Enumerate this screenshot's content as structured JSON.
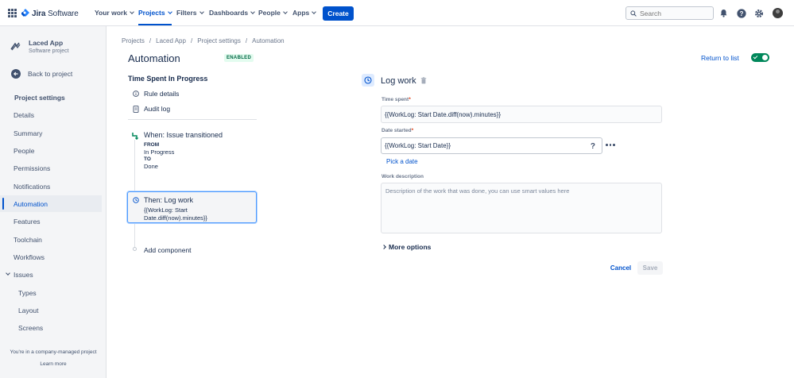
{
  "topnav": {
    "product_name_bold": "Jira",
    "product_name_light": " Software",
    "items": [
      {
        "label": "Your work",
        "active": false
      },
      {
        "label": "Projects",
        "active": true
      },
      {
        "label": "Filters",
        "active": false
      },
      {
        "label": "Dashboards",
        "active": false
      },
      {
        "label": "People",
        "active": false
      },
      {
        "label": "Apps",
        "active": false
      }
    ],
    "create_label": "Create",
    "search_placeholder": "Search",
    "icons": [
      "app-switcher-icon",
      "notification-icon",
      "help-icon",
      "settings-icon",
      "avatar"
    ]
  },
  "sidebar": {
    "project_name": "Laced App",
    "project_type": "Software project",
    "back_label": "Back to project",
    "heading": "Project settings",
    "items": [
      {
        "label": "Details"
      },
      {
        "label": "Summary"
      },
      {
        "label": "People"
      },
      {
        "label": "Permissions"
      },
      {
        "label": "Notifications"
      },
      {
        "label": "Automation",
        "active": true
      },
      {
        "label": "Features"
      },
      {
        "label": "Toolchain"
      },
      {
        "label": "Workflows"
      },
      {
        "label": "Issues"
      },
      {
        "label": "Types"
      },
      {
        "label": "Layout"
      },
      {
        "label": "Screens"
      }
    ],
    "footer_text": "You're in a company-managed project",
    "footer_link": "Learn more"
  },
  "breadcrumb": [
    "Projects",
    "/",
    "Laced App",
    "/",
    "Project settings",
    "/",
    "Automation"
  ],
  "page": {
    "title": "Automation",
    "status_badge": "ENABLED",
    "return_link": "Return to list",
    "rule_enabled": true
  },
  "rule": {
    "title": "Time Spent In Progress",
    "links": [
      {
        "label": "Rule details",
        "icon": "info-icon"
      },
      {
        "label": "Audit log",
        "icon": "document-icon"
      }
    ],
    "trigger": {
      "title": "When: Issue transitioned",
      "from_label": "FROM",
      "from_value": "In Progress",
      "to_label": "TO",
      "to_value": "Done"
    },
    "action": {
      "title": "Then: Log work",
      "value": "{{WorkLog: Start Date.diff(now).minutes}}"
    },
    "add_component": "Add component"
  },
  "panel": {
    "title": "Log work",
    "time_spent_label": "Time spent",
    "time_spent_value": "{{WorkLog: Start Date.diff(now).minutes}}",
    "date_started_label": "Date started",
    "date_started_value": "{{WorkLog: Start Date}}",
    "help_glyph": "?",
    "pick_date": "Pick a date",
    "work_description_label": "Work description",
    "work_description_placeholder": "Description of the work that was done, you can use smart values here",
    "more_options": "More options",
    "cancel": "Cancel",
    "save": "Save",
    "required_mark": "*"
  },
  "colors": {
    "primary": "#0052cc",
    "enabled_green": "#00875a",
    "text": "#172b4d",
    "subtle": "#6b778c"
  }
}
